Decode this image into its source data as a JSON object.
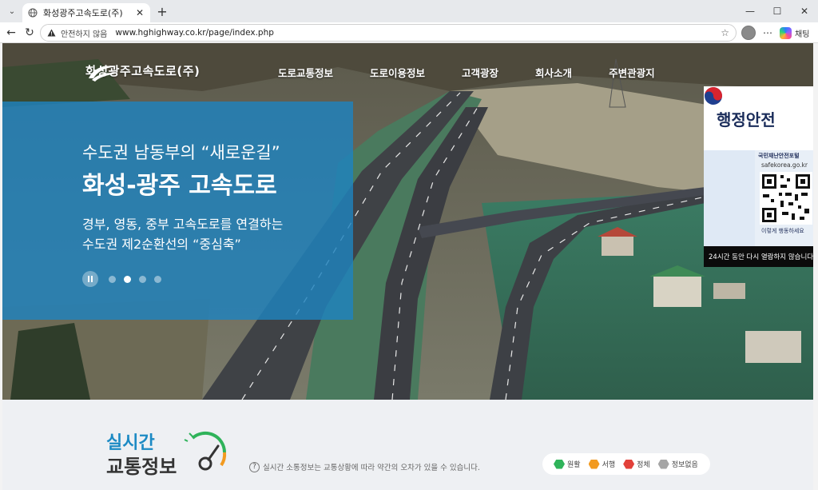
{
  "browser": {
    "tab_title": "화성광주고속도로(주)",
    "security_label": "안전하지 않음",
    "url": "www.hghighway.co.kr/page/index.php",
    "copilot_label": "채팅"
  },
  "site": {
    "brand_name": "화성광주고속도로(주)",
    "nav": [
      "도로교통정보",
      "도로이용정보",
      "고객광장",
      "회사소개",
      "주변관광지"
    ]
  },
  "hero": {
    "line1": "수도권 남동부의 “새로운길”",
    "line2": "화성-광주 고속도로",
    "line3": "경부, 영동, 중부 고속도로를 연결하는",
    "line4": "수도권 제2순환선의 “중심축”",
    "slides_total": 4,
    "slide_active": 2
  },
  "popup": {
    "agency": "행정안전",
    "qr_title": "국민재난안전포털",
    "qr_url": "safekorea.go.kr",
    "qr_cta": "이렇게 행동하세요",
    "footer": "24시간 동안 다시 열람하지 않습니다"
  },
  "traffic": {
    "title1": "실시간",
    "title2": "교통정보",
    "notice": "실시간 소통정보는 교통상황에 따라 약간의 오차가 있을 수 있습니다.",
    "legend": [
      {
        "label": "원활",
        "color": "#2fb35a"
      },
      {
        "label": "서행",
        "color": "#f29a1f"
      },
      {
        "label": "정체",
        "color": "#e2413a"
      },
      {
        "label": "정보없음",
        "color": "#a5a5a5"
      }
    ]
  }
}
